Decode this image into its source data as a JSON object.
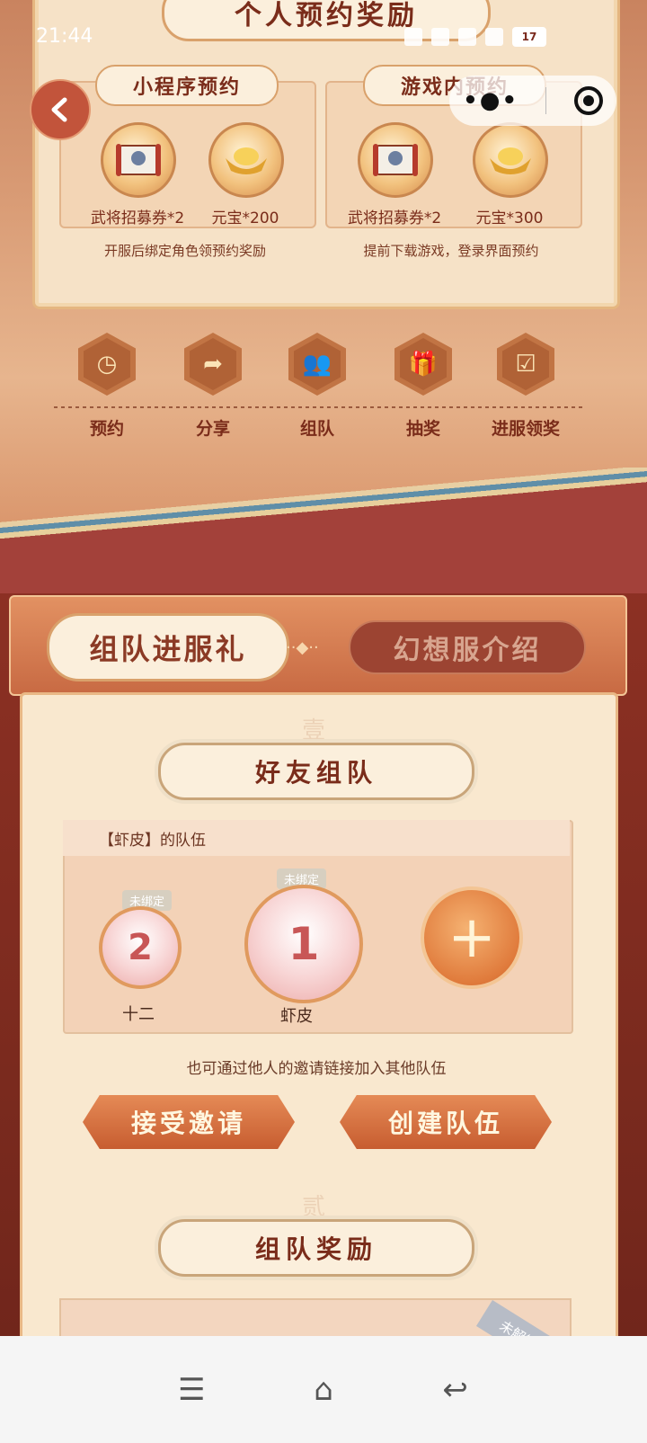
{
  "status_bar": {
    "time": "21:44",
    "battery": "17"
  },
  "top_card": {
    "title": "个人预约奖励",
    "left": {
      "title": "小程序预约",
      "rewards": [
        "武将招募券*2",
        "元宝*200"
      ],
      "note": "开服后绑定角色领预约奖励"
    },
    "right": {
      "title": "游戏内预约",
      "rewards": [
        "武将招募券*2",
        "元宝*300"
      ],
      "note": "提前下载游戏，登录界面预约"
    }
  },
  "nav": [
    {
      "label": "预约",
      "icon": "clock-icon"
    },
    {
      "label": "分享",
      "icon": "share-icon"
    },
    {
      "label": "组队",
      "icon": "team-icon"
    },
    {
      "label": "抽奖",
      "icon": "gift-icon"
    },
    {
      "label": "进服领奖",
      "icon": "calendar-check-icon"
    }
  ],
  "tabs": {
    "active": "组队进服礼",
    "inactive": "幻想服介绍"
  },
  "team_section": {
    "number": "壹",
    "title": "好友组队",
    "team_header": "【虾皮】的队伍",
    "members": [
      {
        "rank": "2",
        "badge": "未绑定",
        "name": "十二"
      },
      {
        "rank": "1",
        "badge": "未绑定",
        "name": "虾皮"
      }
    ],
    "hint": "也可通过他人的邀请链接加入其他队伍",
    "accept_label": "接受邀请",
    "create_label": "创建队伍"
  },
  "reward_section": {
    "number": "贰",
    "title": "组队奖励",
    "lock_label": "未解锁"
  },
  "colors": {
    "brand": "#c2543b",
    "accent": "#e58a56",
    "text": "#7a2c1a"
  }
}
